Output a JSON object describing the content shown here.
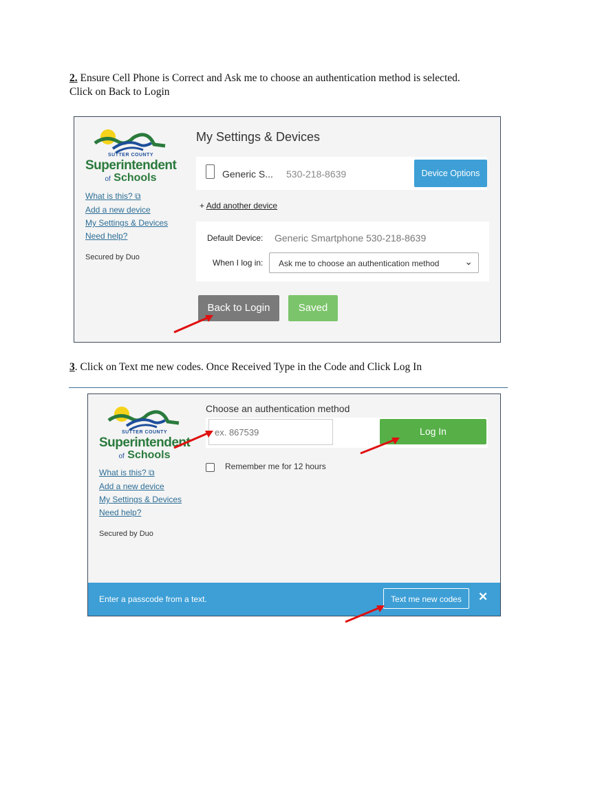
{
  "step2": {
    "number": "2.",
    "line1": "Ensure Cell Phone is Correct and Ask me to choose an authentication method is selected.",
    "line2": "Click on Back to Login"
  },
  "step3": {
    "number": "3",
    "text": ". Click on Text me new codes.  Once Received  Type in the Code and Click Log In"
  },
  "logo": {
    "line1": "SUTTER COUNTY",
    "line2": "Superintendent",
    "line3_of": "of",
    "line3": "Schools"
  },
  "sidebar": {
    "what_is_this": "What is this?",
    "add_device": "Add a new device",
    "my_settings": "My Settings & Devices",
    "need_help": "Need help?",
    "secured": "Secured by Duo"
  },
  "panel1": {
    "title": "My Settings & Devices",
    "device_name": "Generic S...",
    "device_phone": "530-218-8639",
    "device_options": "Device Options",
    "add_another": "Add another device",
    "add_plus": "+",
    "default_device_label": "Default Device:",
    "default_device_value": "Generic Smartphone 530-218-8639",
    "when_login_label": "When I log in:",
    "when_login_value": "Ask me to choose an authentication method",
    "back_to_login": "Back to Login",
    "saved": "Saved"
  },
  "panel2": {
    "title": "Choose an authentication method",
    "passcode_placeholder": "ex. 867539",
    "log_in": "Log In",
    "remember": "Remember me for 12 hours",
    "footer_text": "Enter a passcode from a text.",
    "text_me": "Text me new codes",
    "close": "✕"
  },
  "colors": {
    "blue_button": "#3d9fd6",
    "green_button": "#56b047",
    "gray_button": "#7a7a7a",
    "saved_green": "#7cc46b",
    "footer_blue": "#3d9fd6",
    "arrow_red": "#e01010"
  }
}
